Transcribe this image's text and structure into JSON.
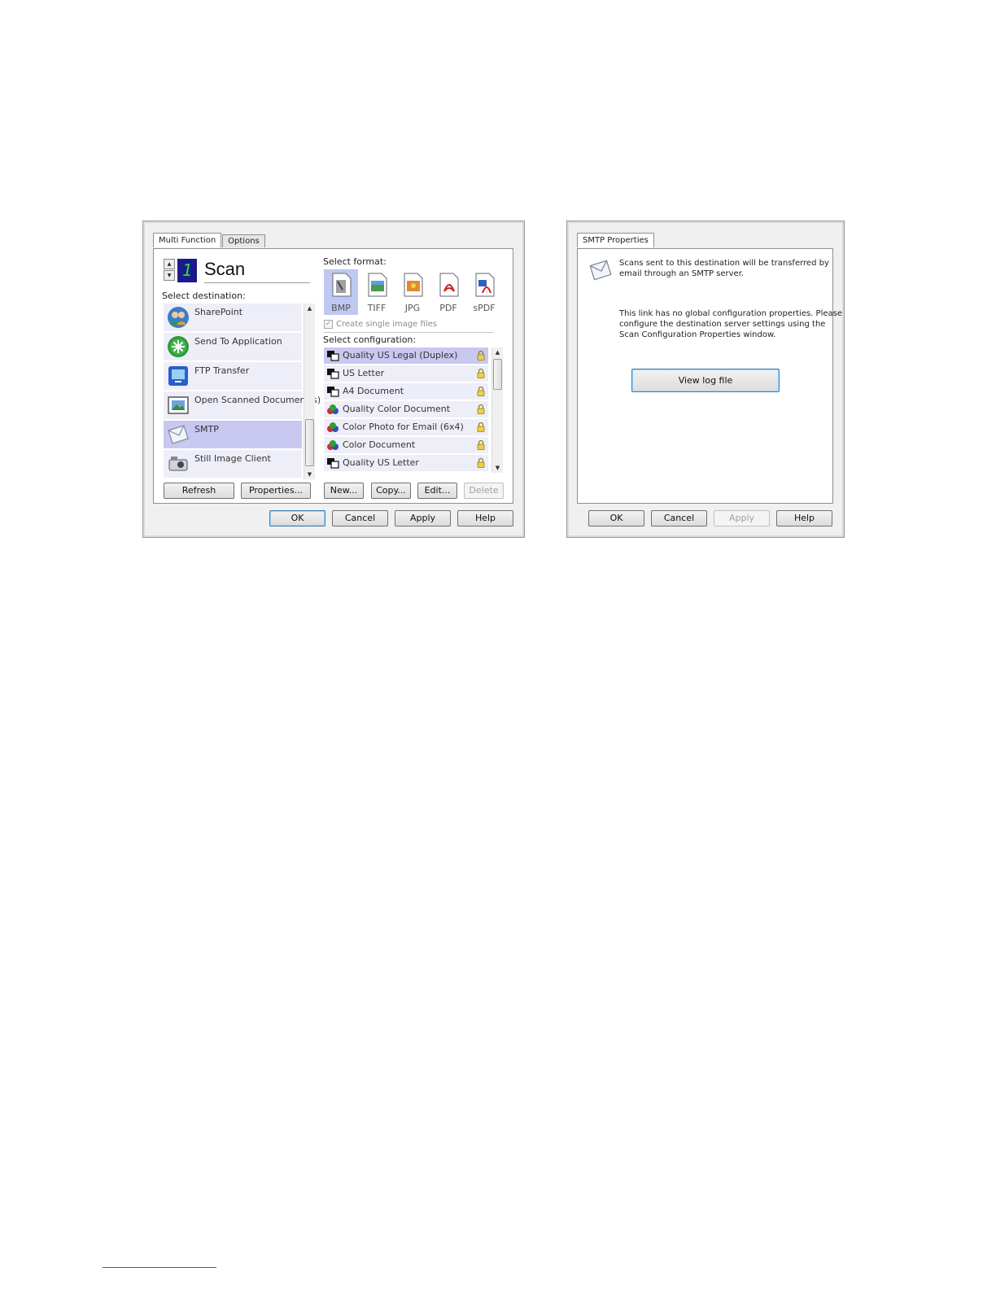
{
  "left_dialog": {
    "tabs": [
      {
        "label": "Multi Function",
        "active": true
      },
      {
        "label": "Options",
        "active": false
      }
    ],
    "counter_value": "1",
    "scan_label": "Scan",
    "select_destination_label": "Select destination:",
    "destinations": [
      {
        "label": "SharePoint",
        "icon": "sharepoint-icon"
      },
      {
        "label": "Send To Application",
        "icon": "send-to-application-icon"
      },
      {
        "label": "FTP Transfer",
        "icon": "ftp-transfer-icon"
      },
      {
        "label": "Open Scanned Document(s)",
        "icon": "open-document-icon"
      },
      {
        "label": "SMTP",
        "icon": "smtp-envelope-icon",
        "selected": true
      },
      {
        "label": "Still Image Client",
        "icon": "still-image-client-icon"
      }
    ],
    "select_format_label": "Select format:",
    "formats": [
      {
        "label": "BMP",
        "selected": true
      },
      {
        "label": "TIFF"
      },
      {
        "label": "JPG"
      },
      {
        "label": "PDF"
      },
      {
        "label": "sPDF"
      }
    ],
    "create_single_files_label": "Create single image files",
    "select_configuration_label": "Select configuration:",
    "configurations": [
      {
        "label": "Quality US Legal (Duplex)",
        "color": false,
        "selected": true
      },
      {
        "label": "US Letter",
        "color": false
      },
      {
        "label": "A4 Document",
        "color": false
      },
      {
        "label": "Quality Color Document",
        "color": true
      },
      {
        "label": "Color Photo for Email (6x4)",
        "color": true
      },
      {
        "label": "Color Document",
        "color": true
      },
      {
        "label": "Quality US Letter",
        "color": false
      }
    ],
    "buttons": {
      "refresh": "Refresh",
      "properties": "Properties...",
      "new": "New...",
      "copy": "Copy...",
      "edit": "Edit...",
      "delete": "Delete",
      "ok": "OK",
      "cancel": "Cancel",
      "apply": "Apply",
      "help": "Help"
    }
  },
  "right_dialog": {
    "tab_label": "SMTP Properties",
    "description": "Scans sent to this destination will be transferred by email through an SMTP server.",
    "description_line1": "Scans sent to this destination will be transferred by",
    "description_line2": "email through an SMTP server.",
    "note_line1": "This link has no global configuration properties. Please",
    "note_line2": "configure the destination server settings using the",
    "note_line3": "Scan Configuration Properties window.",
    "view_log_button": "View log file",
    "buttons": {
      "ok": "OK",
      "cancel": "Cancel",
      "apply": "Apply",
      "help": "Help"
    }
  }
}
